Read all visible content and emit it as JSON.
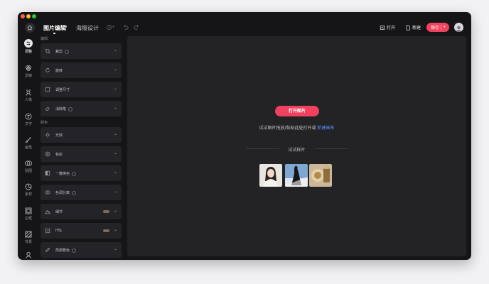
{
  "toolbar": {
    "tabs": [
      "图片编辑",
      "海报设计"
    ],
    "open_label": "打开",
    "new_label": "新建",
    "save_label": "保存"
  },
  "sidebar": {
    "items": [
      "调整",
      "滤镜",
      "人像",
      "文字",
      "画笔",
      "贴图",
      "素材",
      "边框",
      "背景",
      ""
    ]
  },
  "panel": {
    "sections": [
      "编辑",
      "颜色"
    ],
    "edit_rows": [
      "裁剪",
      "旋转",
      "调整尺寸",
      "消除笔"
    ],
    "color_rows": [
      "光效",
      "色彩",
      "一键换色",
      "色调分离",
      "细节",
      "HSL",
      "局部着色"
    ]
  },
  "canvas": {
    "open_button": "打开图片",
    "hint_prefix": "试试图片拖放/粘贴此处打开或",
    "hint_link": "新建画布",
    "samples_title": "试试样片"
  },
  "colors": {
    "accent": "#f0415e",
    "link": "#5b8cff"
  }
}
